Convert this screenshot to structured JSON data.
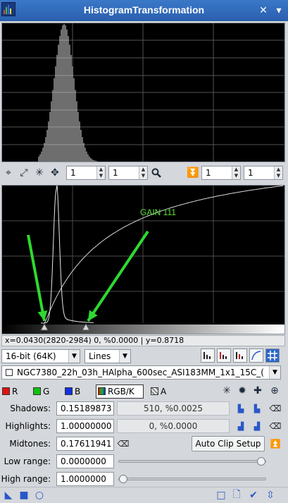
{
  "window": {
    "title": "HistogramTransformation"
  },
  "zoom_controls": {
    "h_zoom": "1",
    "v_zoom": "1",
    "h_zoom2": "1",
    "v_zoom2": "1"
  },
  "annotation": {
    "gain_label": "GAIN 111",
    "gain_color": "#5ee13a",
    "arrow_color": "#2fd92f"
  },
  "cursor_readout": "x=0.0430(2820-2984) 0, %0.0000 | y=0.8718",
  "display": {
    "bit_depth": "16-bit (64K)",
    "graph_style": "Lines"
  },
  "view": {
    "selected_image": "NGC7380_22h_03h_HAlpha_600sec_ASI183MM_1x1_15C_("
  },
  "channels": [
    {
      "label": "R",
      "color": "#e01010"
    },
    {
      "label": "G",
      "color": "#10c010"
    },
    {
      "label": "B",
      "color": "#1030e0"
    },
    {
      "label": "RGB/K",
      "color": "#ffffff"
    },
    {
      "label": "A",
      "color": "#ffffff"
    }
  ],
  "params": {
    "shadows_label": "Shadows:",
    "shadows_value": "0.15189873",
    "shadows_readout": "510, %0.0025",
    "highlights_label": "Highlights:",
    "highlights_value": "1.00000000",
    "highlights_readout": "0, %0.0000",
    "midtones_label": "Midtones:",
    "midtones_value": "0.17611941",
    "auto_clip_label": "Auto Clip Setup",
    "low_range_label": "Low range:",
    "low_range_value": "0.0000000",
    "low_range_fraction": 1.0,
    "high_range_label": "High range:",
    "high_range_value": "1.0000000",
    "high_range_fraction": 0.0
  }
}
